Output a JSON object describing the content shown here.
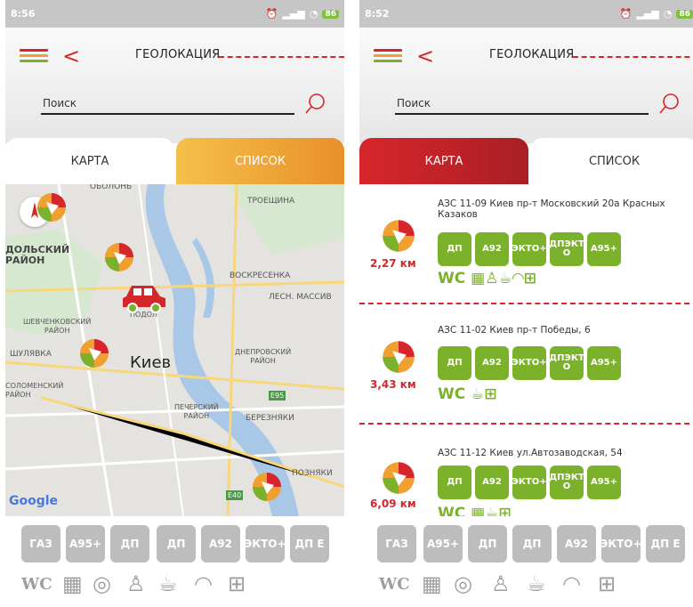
{
  "screens": [
    {
      "time": "8:56",
      "battery": "86",
      "title": "ГЕОЛОКАЦИЯ",
      "search_placeholder": "Поиск",
      "tabs": [
        "КАРТА",
        "СПИСОК"
      ],
      "map_labels": {
        "obolon": "ОБОЛОНЬ",
        "troeshina": "ТРОЕЩИНА",
        "podolskiy": "ДОЛЬСКИЙ\nРАЙОН",
        "voskresenka": "ВОСКРЕСЕНКА",
        "lesnoy": "ЛЕСН. МАССИВ",
        "shevchenk": "ШЕВЧЕНКОВСКИЙ\nРАЙОН",
        "podol": "ПОДОЛ",
        "shulyavka": "ШУЛЯВКА",
        "kiev": "Киев",
        "dnepr": "ДНЕПРОВСКИЙ\nРАЙОН",
        "solom": "СОЛОМЕНСКИЙ\nРАЙОН",
        "e95": "E95",
        "berezn": "БЕРЕЗНЯКИ",
        "pecher": "ПЕЧЕРСКИЙ\nРАЙОН",
        "pozn": "ПОЗНЯКИ",
        "e40": "E40",
        "google": "Google"
      },
      "filters": [
        "ГАЗ",
        "А95+",
        "ДП",
        "ДП",
        "А92",
        "ЭКТО+",
        "ДП Е"
      ],
      "wc": "WC"
    },
    {
      "time": "8:52",
      "battery": "86",
      "title": "ГЕОЛОКАЦИЯ",
      "search_placeholder": "Поиск",
      "tabs": [
        "КАРТА",
        "СПИСОК"
      ],
      "stations": [
        {
          "address": "АЗС 11-09 Киев пр-т Московский 20а Красных Казаков",
          "distance": "2,27 км",
          "fuels": [
            "ДП",
            "А92",
            "ЭКТО+",
            "ДПЭКТ О",
            "А95+"
          ]
        },
        {
          "address": "АЗС 11-02 Киев пр-т Победы, 6",
          "distance": "3,43 км",
          "fuels": [
            "ДП",
            "А92",
            "ЭКТО+",
            "ДПЭКТ О",
            "А95+"
          ]
        },
        {
          "address": "АЗС 11-12 Киев ул.Автозаводская, 54",
          "distance": "6,09 км",
          "fuels": [
            "ДП",
            "А92",
            "ЭКТО+",
            "ДПЭКТ О",
            "А95+"
          ]
        }
      ],
      "filters": [
        "ГАЗ",
        "А95+",
        "ДП",
        "ДП",
        "А92",
        "ЭКТО+",
        "ДП Е"
      ],
      "wc": "WC"
    }
  ],
  "colors": {
    "red": "#d7262b",
    "orange": "#f0a030",
    "green": "#7cb12c",
    "grey_chip": "#bdbdbd"
  }
}
